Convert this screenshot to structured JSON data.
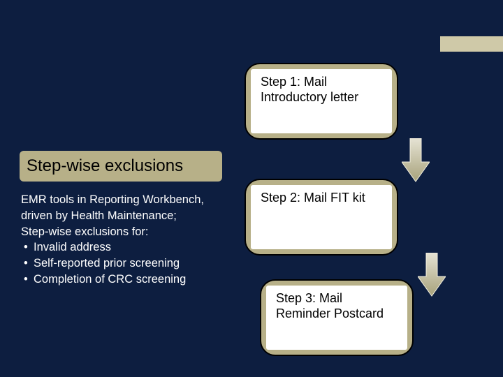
{
  "corner_accent_color": "#cfc9a8",
  "title": "Step-wise exclusions",
  "body": {
    "lead": "EMR tools in Reporting Workbench, driven by Health Maintenance;\nStep-wise exclusions for:",
    "bullets": [
      "Invalid address",
      "Self-reported prior screening",
      "Completion of CRC screening"
    ]
  },
  "steps": [
    {
      "label": "Step 1: Mail Introductory letter"
    },
    {
      "label": "Step 2: Mail FIT kit"
    },
    {
      "label": "Step 3: Mail Reminder Postcard"
    }
  ],
  "colors": {
    "bg": "#0d1e40",
    "card": "#b7b088",
    "accent": "#cfc9a8",
    "arrow_fill": "#a8a27b",
    "arrow_stroke": "#e6e3d4"
  }
}
